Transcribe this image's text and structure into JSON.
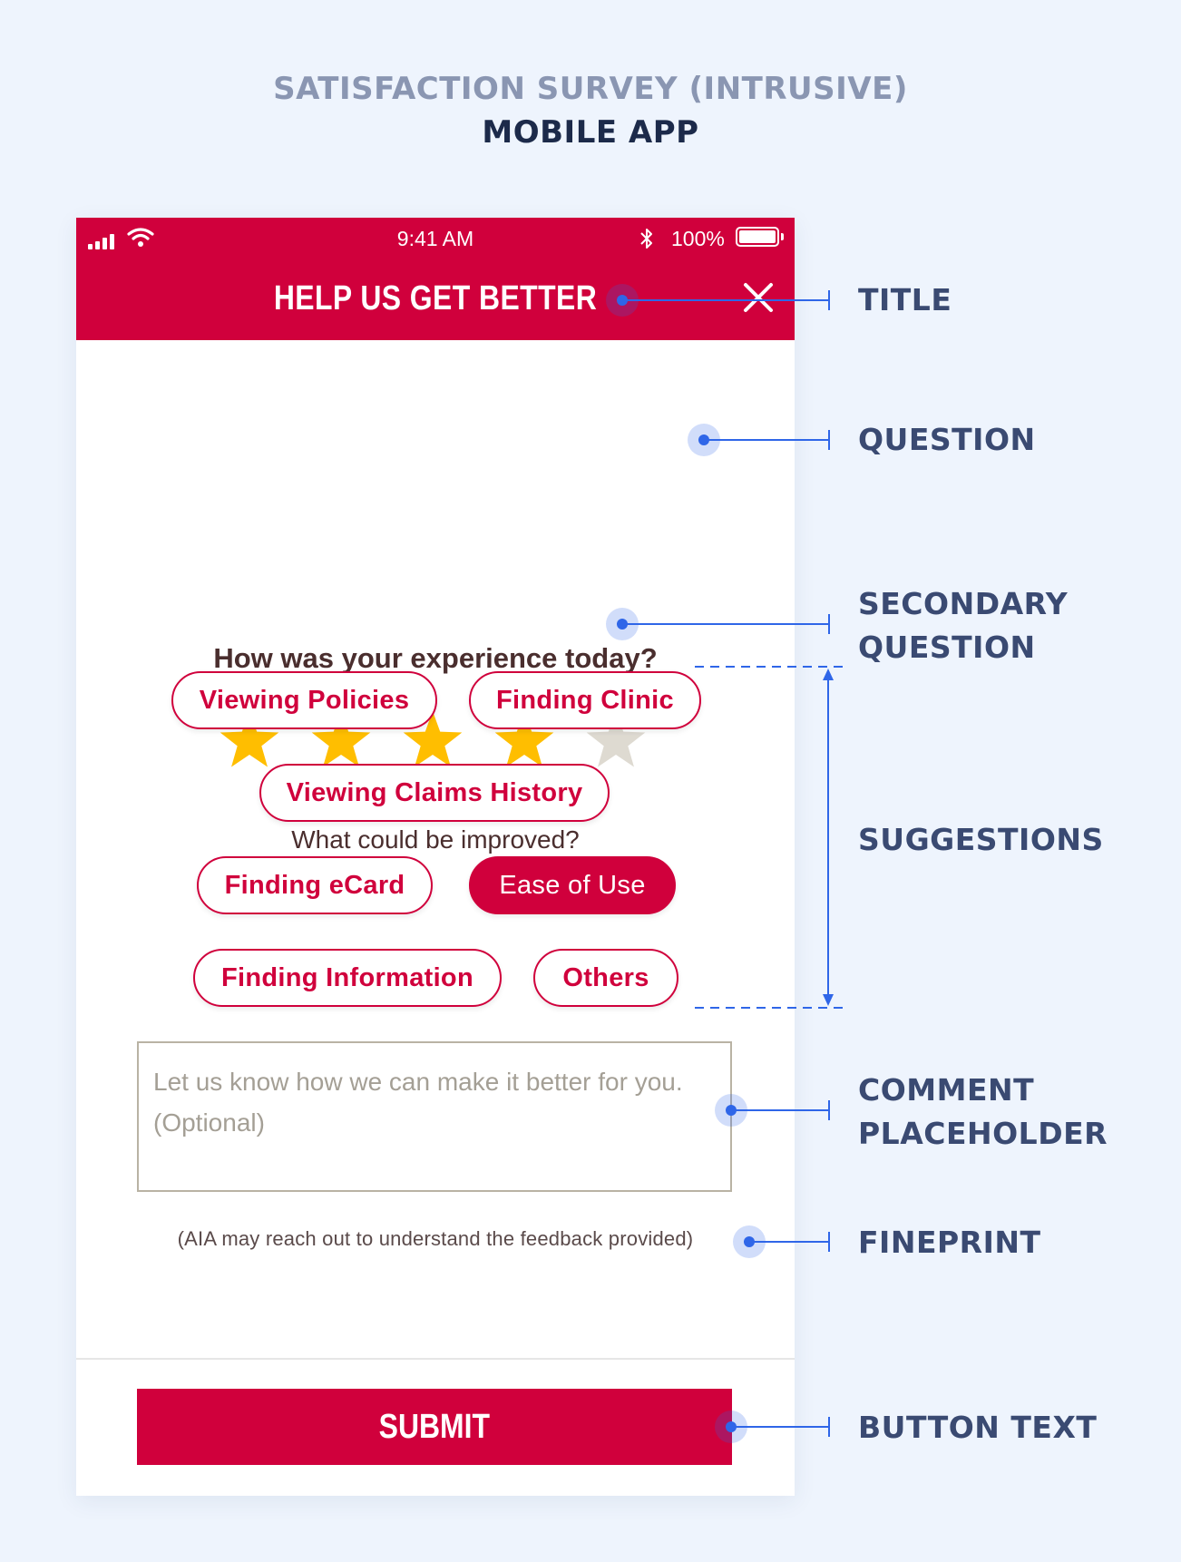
{
  "header": {
    "title": "SATISFACTION SURVEY (INTRUSIVE)",
    "subtitle": "MOBILE APP"
  },
  "status_bar": {
    "time": "9:41 AM",
    "battery": "100%"
  },
  "app_bar": {
    "title": "HELP US GET BETTER",
    "close_icon": "close-icon"
  },
  "survey": {
    "question": "How was your experience today?",
    "rating": {
      "value": 4,
      "max": 5
    },
    "secondary_question": "What could be improved?",
    "suggestions": [
      {
        "label": "Viewing Policies",
        "selected": false
      },
      {
        "label": "Finding Clinic",
        "selected": false
      },
      {
        "label": "Viewing Claims History",
        "selected": false
      },
      {
        "label": "Finding eCard",
        "selected": false
      },
      {
        "label": "Ease of Use",
        "selected": true
      },
      {
        "label": "Finding Information",
        "selected": false
      },
      {
        "label": "Others",
        "selected": false
      }
    ],
    "comment_placeholder": "Let us know how we can make it better for you. (Optional)",
    "fineprint": "(AIA may reach out to understand the feedback provided)",
    "submit_label": "SUBMIT"
  },
  "annotations": {
    "title": "TITLE",
    "question": "QUESTION",
    "secondary_question": [
      "SECONDARY",
      "QUESTION"
    ],
    "suggestions": "SUGGESTIONS",
    "comment_placeholder": [
      "COMMENT",
      "PLACEHOLDER"
    ],
    "fineprint": "FINEPRINT",
    "button_text": "BUTTON TEXT"
  },
  "colors": {
    "brand": "#d0003c",
    "star_filled": "#ffbe00",
    "star_empty": "#dedad1",
    "annotation_line": "#2f66e8",
    "annotation_label": "#3a4a72",
    "background": "#eef4fd"
  }
}
